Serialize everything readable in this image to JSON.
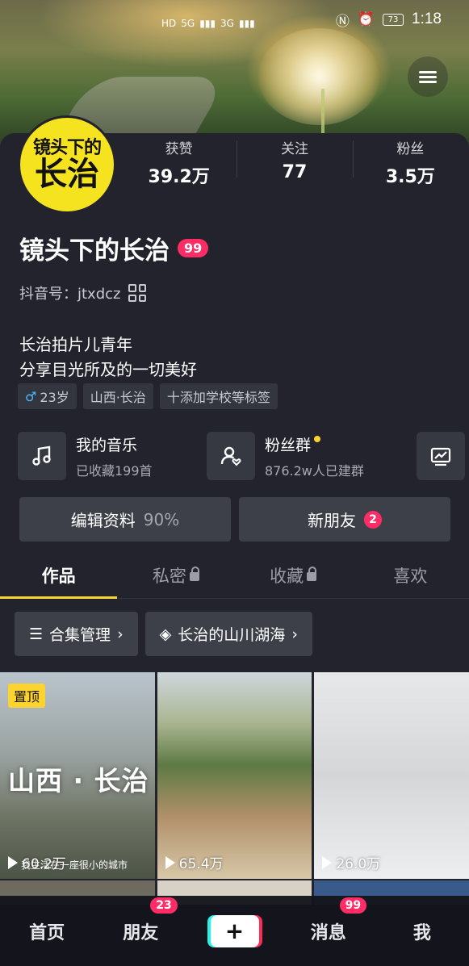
{
  "status_bar": {
    "left_indicators": [
      "HD",
      "5G",
      "3G"
    ],
    "battery": "73",
    "time": "1:18"
  },
  "profile": {
    "avatar_text_top": "镜头下的",
    "avatar_text_bottom": "长治",
    "stats": [
      {
        "label": "获赞",
        "value": "39.2万"
      },
      {
        "label": "关注",
        "value": "77"
      },
      {
        "label": "粉丝",
        "value": "3.5万"
      }
    ],
    "name": "镜头下的长治",
    "name_badge": "99",
    "douyin_id": "抖音号：jtxdcz",
    "bio_lines": [
      "长治拍片儿青年",
      "分享目光所及的一切美好"
    ],
    "tags": {
      "gender_age": "23岁",
      "location": "山西·长治",
      "add_school": "十添加学校等标签"
    }
  },
  "features": {
    "music": {
      "title": "我的音乐",
      "subtitle": "已收藏199首"
    },
    "fans_group": {
      "title": "粉丝群",
      "subtitle": "876.2w人已建群"
    }
  },
  "actions": {
    "edit_label": "编辑资料",
    "edit_percent": "90%",
    "friends_label": "新朋友",
    "friends_badge": "2"
  },
  "tabs": [
    "作品",
    "私密",
    "收藏",
    "喜欢"
  ],
  "chips": {
    "collection_manage": "合集管理",
    "collection_name": "长治的山川湖海"
  },
  "videos": [
    {
      "pinned": "置顶",
      "title": "山西 · 长治",
      "caption": "我生活在一座很小的城市",
      "plays": "60.2万"
    },
    {
      "plays": "65.4万"
    },
    {
      "plays": "26.0万"
    }
  ],
  "bottom_nav": {
    "home": "首页",
    "friends": "朋友",
    "friends_badge": "23",
    "plus": "+",
    "messages": "消息",
    "messages_badge": "99",
    "me": "我"
  }
}
